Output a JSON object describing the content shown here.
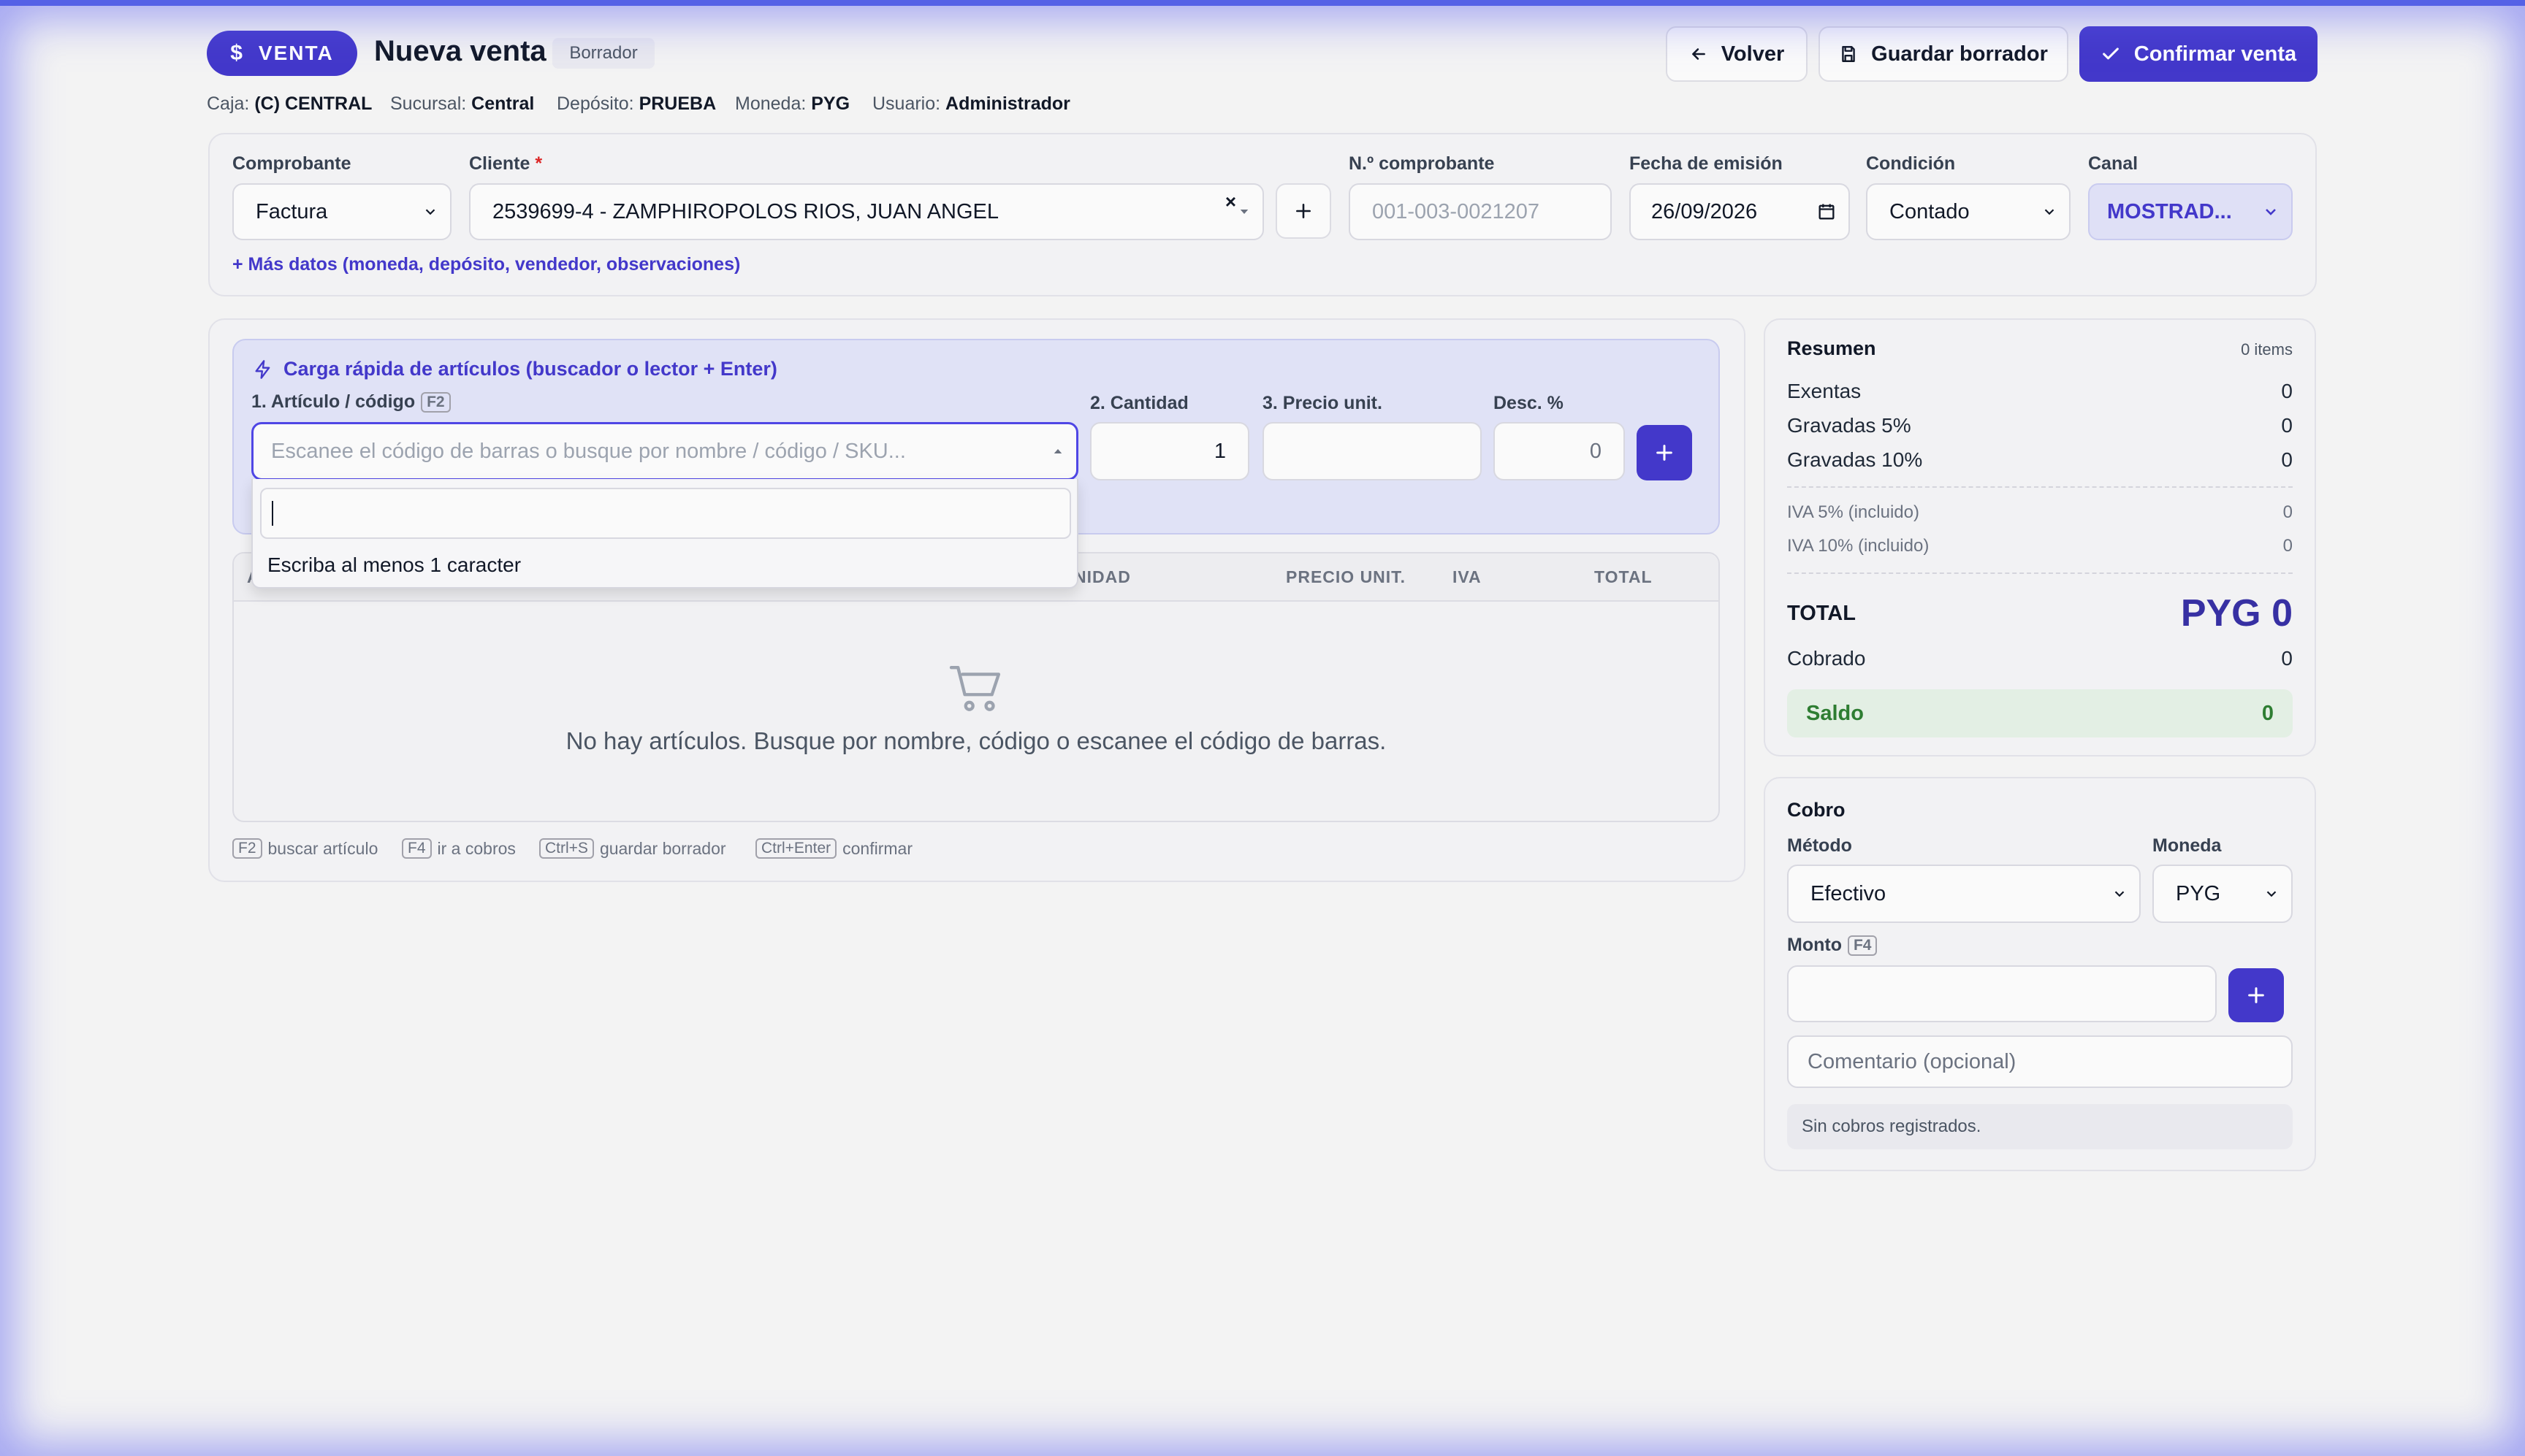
{
  "header": {
    "badge_label": "VENTA",
    "title": "Nueva venta",
    "status": "Borrador",
    "buttons": {
      "back": "Volver",
      "save_draft": "Guardar borrador",
      "confirm": "Confirmar venta"
    },
    "meta": [
      {
        "key": "Caja:",
        "value": "(C) CENTRAL"
      },
      {
        "key": "Sucursal:",
        "value": "Central"
      },
      {
        "key": "Depósito:",
        "value": "PRUEBA"
      },
      {
        "key": "Moneda:",
        "value": "PYG"
      },
      {
        "key": "Usuario:",
        "value": "Administrador"
      }
    ]
  },
  "form": {
    "comprobante": {
      "label": "Comprobante",
      "value": "Factura"
    },
    "cliente": {
      "label": "Cliente",
      "required_mark": "*",
      "value": "2539699-4 - ZAMPHIROPOLOS RIOS, JUAN ANGEL"
    },
    "nro_comprobante": {
      "label": "N.º comprobante",
      "placeholder": "001-003-0021207"
    },
    "fecha": {
      "label": "Fecha de emisión",
      "value": "26/09/2026"
    },
    "condicion": {
      "label": "Condición",
      "value": "Contado"
    },
    "canal": {
      "label": "Canal",
      "value": "MOSTRAD..."
    },
    "more_link": "+ Más datos (moneda, depósito, vendedor, observaciones)"
  },
  "quick_load": {
    "title": "Carga rápida de artículos (buscador o lector + Enter)",
    "articulo_label": "1. Artículo / código",
    "articulo_key": "F2",
    "articulo_placeholder": "Escanee el código de barras o busque por nombre / código / SKU...",
    "cantidad_label": "2. Cantidad",
    "cantidad_value": "1",
    "precio_label": "3. Precio unit.",
    "desc_label": "Desc. %",
    "desc_value": "0",
    "dropdown_message": "Escriba al menos 1 caracter"
  },
  "table": {
    "headers": [
      "A",
      "NIDAD",
      "PRECIO UNIT.",
      "IVA",
      "TOTAL"
    ],
    "empty_message": "No hay artículos. Busque por nombre, código o escanee el código de barras."
  },
  "shortcuts": [
    {
      "key": "F2",
      "text": "buscar artículo"
    },
    {
      "key": "F4",
      "text": "ir a cobros"
    },
    {
      "key": "Ctrl+S",
      "text": "guardar borrador"
    },
    {
      "key": "Ctrl+Enter",
      "text": "confirmar"
    }
  ],
  "summary": {
    "title": "Resumen",
    "items_count": "0 items",
    "rows": [
      {
        "label": "Exentas",
        "value": "0"
      },
      {
        "label": "Gravadas 5%",
        "value": "0"
      },
      {
        "label": "Gravadas 10%",
        "value": "0"
      }
    ],
    "iva_rows": [
      {
        "label": "IVA 5% (incluido)",
        "value": "0"
      },
      {
        "label": "IVA 10% (incluido)",
        "value": "0"
      }
    ],
    "total_label": "TOTAL",
    "total_value": "PYG 0",
    "cobrado_label": "Cobrado",
    "cobrado_value": "0",
    "saldo_label": "Saldo",
    "saldo_value": "0"
  },
  "cobro": {
    "title": "Cobro",
    "metodo_label": "Método",
    "metodo_value": "Efectivo",
    "moneda_label": "Moneda",
    "moneda_value": "PYG",
    "monto_label": "Monto",
    "monto_key": "F4",
    "comment_placeholder": "Comentario (opcional)",
    "empty": "Sin cobros registrados."
  },
  "colors": {
    "primary": "#4338ca",
    "saldo_bg": "#e3efe4",
    "saldo_text": "#2e7d32"
  }
}
